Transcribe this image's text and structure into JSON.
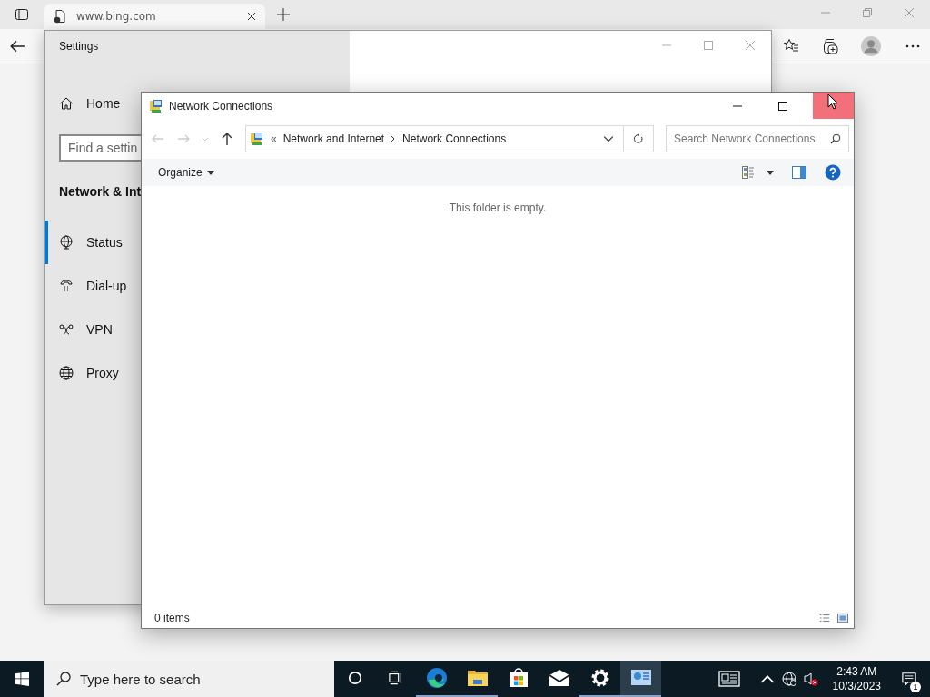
{
  "browser": {
    "tabs": [
      {
        "title": "www.bing.com",
        "selected": true
      }
    ]
  },
  "settings_window": {
    "title": "Settings",
    "home": "Home",
    "search": {
      "placeholder": "Find a settin"
    },
    "section": "Network & Int",
    "nav": [
      {
        "kind": "status",
        "label": "Status",
        "selected": true
      },
      {
        "kind": "dialup",
        "label": "Dial-up",
        "selected": false
      },
      {
        "kind": "vpn",
        "label": "VPN",
        "selected": false
      },
      {
        "kind": "proxy",
        "label": "Proxy",
        "selected": false
      }
    ]
  },
  "explorer_window": {
    "title": "Network Connections",
    "breadcrumb": [
      "«",
      "Network and Internet",
      "Network Connections"
    ],
    "search": {
      "placeholder": "Search Network Connections"
    },
    "organize": "Organize",
    "empty_message": "This folder is empty.",
    "status": "0 items"
  },
  "taskbar": {
    "search": {
      "placeholder": "Type here to search"
    },
    "apps": [
      {
        "kind": "cortana",
        "open": false,
        "selected": false
      },
      {
        "kind": "taskview",
        "open": false,
        "selected": false
      },
      {
        "kind": "edge",
        "open": true,
        "selected": false
      },
      {
        "kind": "explorer",
        "open": true,
        "selected": false
      },
      {
        "kind": "store",
        "open": false,
        "selected": false
      },
      {
        "kind": "mail",
        "open": false,
        "selected": false
      },
      {
        "kind": "settings",
        "open": true,
        "selected": false
      },
      {
        "kind": "network",
        "open": true,
        "selected": true
      }
    ],
    "time": "2:43 AM",
    "date": "10/3/2023",
    "notification_count": "1"
  }
}
